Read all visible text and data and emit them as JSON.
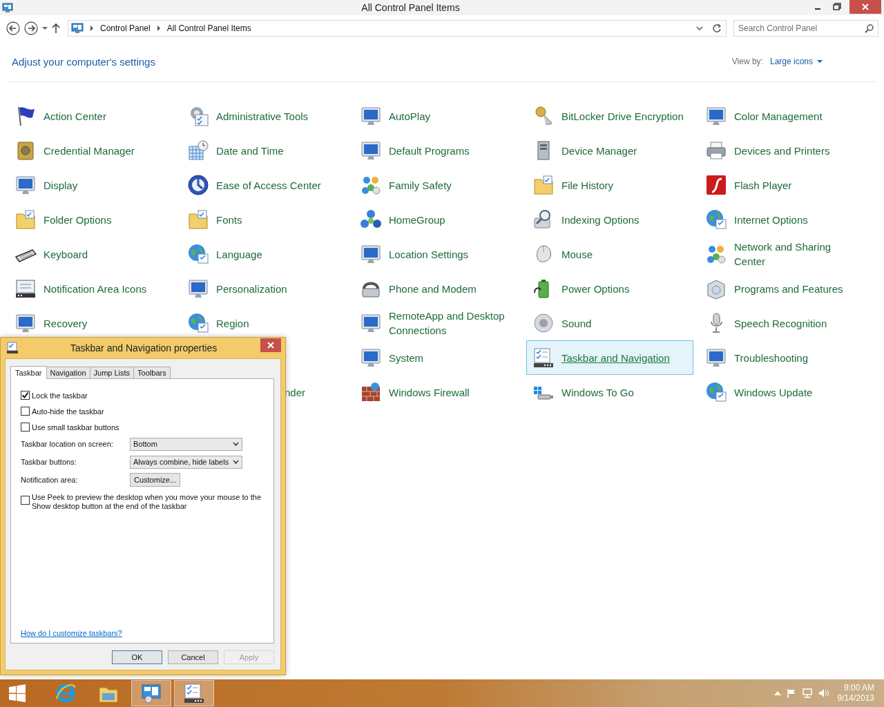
{
  "window": {
    "title": "All Control Panel Items"
  },
  "address_bar": {
    "breadcrumbs": [
      "Control Panel",
      "All Control Panel Items"
    ]
  },
  "search": {
    "placeholder": "Search Control Panel"
  },
  "heading": "Adjust your computer's settings",
  "view_by": {
    "label": "View by:",
    "value": "Large icons"
  },
  "items": [
    {
      "kind": "item",
      "label": "Action Center",
      "selected": false
    },
    {
      "kind": "item",
      "label": "Administrative Tools",
      "selected": false
    },
    {
      "kind": "item",
      "label": "AutoPlay",
      "selected": false
    },
    {
      "kind": "item",
      "label": "BitLocker Drive Encryption",
      "selected": false
    },
    {
      "kind": "item",
      "label": "Color Management",
      "selected": false
    },
    {
      "kind": "item",
      "label": "Credential Manager",
      "selected": false
    },
    {
      "kind": "item",
      "label": "Date and Time",
      "selected": false
    },
    {
      "kind": "item",
      "label": "Default Programs",
      "selected": false
    },
    {
      "kind": "item",
      "label": "Device Manager",
      "selected": false
    },
    {
      "kind": "item",
      "label": "Devices and Printers",
      "selected": false
    },
    {
      "kind": "item",
      "label": "Display",
      "selected": false
    },
    {
      "kind": "item",
      "label": "Ease of Access Center",
      "selected": false
    },
    {
      "kind": "item",
      "label": "Family Safety",
      "selected": false
    },
    {
      "kind": "item",
      "label": "File History",
      "selected": false
    },
    {
      "kind": "item",
      "label": "Flash Player",
      "selected": false
    },
    {
      "kind": "item",
      "label": "Folder Options",
      "selected": false
    },
    {
      "kind": "item",
      "label": "Fonts",
      "selected": false
    },
    {
      "kind": "item",
      "label": "HomeGroup",
      "selected": false
    },
    {
      "kind": "item",
      "label": "Indexing Options",
      "selected": false
    },
    {
      "kind": "item",
      "label": "Internet Options",
      "selected": false
    },
    {
      "kind": "item",
      "label": "Keyboard",
      "selected": false
    },
    {
      "kind": "item",
      "label": "Language",
      "selected": false
    },
    {
      "kind": "item",
      "label": "Location Settings",
      "selected": false
    },
    {
      "kind": "item",
      "label": "Mouse",
      "selected": false
    },
    {
      "kind": "item",
      "label": "Network and Sharing Center",
      "selected": false
    },
    {
      "kind": "item",
      "label": "Notification Area Icons",
      "selected": false
    },
    {
      "kind": "item",
      "label": "Personalization",
      "selected": false
    },
    {
      "kind": "item",
      "label": "Phone and Modem",
      "selected": false
    },
    {
      "kind": "item",
      "label": "Power Options",
      "selected": false
    },
    {
      "kind": "item",
      "label": "Programs and Features",
      "selected": false
    },
    {
      "kind": "item",
      "label": "Recovery",
      "selected": false
    },
    {
      "kind": "item",
      "label": "Region",
      "selected": false
    },
    {
      "kind": "item",
      "label": "RemoteApp and Desktop Connections",
      "selected": false
    },
    {
      "kind": "item",
      "label": "Sound",
      "selected": false
    },
    {
      "kind": "item",
      "label": "Speech Recognition",
      "selected": false
    },
    {
      "kind": "empty"
    },
    {
      "kind": "empty"
    },
    {
      "kind": "item",
      "label": "System",
      "selected": false
    },
    {
      "kind": "item",
      "label": "Taskbar and Navigation",
      "selected": true
    },
    {
      "kind": "item",
      "label": "Troubleshooting",
      "selected": false
    },
    {
      "kind": "empty"
    },
    {
      "kind": "partial",
      "label": "nder"
    },
    {
      "kind": "item",
      "label": "Windows Firewall",
      "selected": false
    },
    {
      "kind": "item",
      "label": "Windows To Go",
      "selected": false
    },
    {
      "kind": "item",
      "label": "Windows Update",
      "selected": false
    }
  ],
  "dialog": {
    "title": "Taskbar and Navigation properties",
    "tabs": [
      {
        "label": "Taskbar",
        "selected": true
      },
      {
        "label": "Navigation",
        "selected": false
      },
      {
        "label": "Jump Lists",
        "selected": false
      },
      {
        "label": "Toolbars",
        "selected": false
      }
    ],
    "checkboxes": [
      {
        "label": "Lock the taskbar",
        "checked": true
      },
      {
        "label": "Auto-hide the taskbar",
        "checked": false
      },
      {
        "label": "Use small taskbar buttons",
        "checked": false
      }
    ],
    "settings": [
      {
        "kind": "dropdown",
        "label": "Taskbar location on screen:",
        "value": "Bottom"
      },
      {
        "kind": "dropdown",
        "label": "Taskbar buttons:",
        "value": "Always combine, hide labels"
      },
      {
        "kind": "button",
        "label": "Notification area:",
        "value": "Customize..."
      }
    ],
    "peek": {
      "label": "Use Peek to preview the desktop when you move your mouse to the Show desktop button at the end of the taskbar",
      "checked": false
    },
    "help_link": "How do I customize taskbars?",
    "buttons": [
      {
        "label": "OK",
        "default": true,
        "disabled": false
      },
      {
        "label": "Cancel",
        "default": false,
        "disabled": false
      },
      {
        "label": "Apply",
        "default": false,
        "disabled": true
      }
    ]
  },
  "taskbar": {
    "apps": [
      {
        "active": false
      },
      {
        "active": false
      },
      {
        "active": true
      },
      {
        "active": true
      }
    ],
    "clock": {
      "time": "9:00 AM",
      "date": "9/14/2013"
    }
  }
}
